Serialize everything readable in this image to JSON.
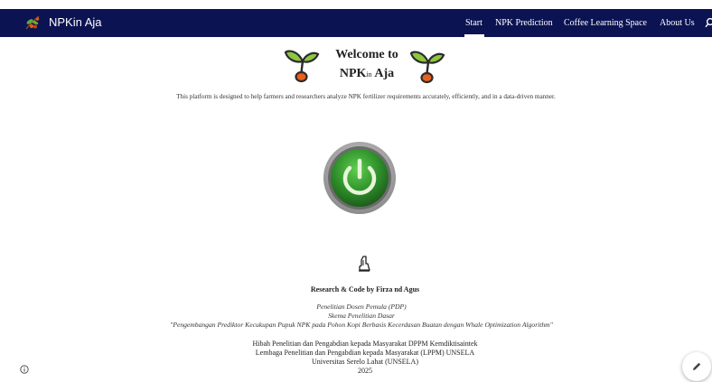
{
  "app": {
    "brand_name": "NPKin Aja",
    "brand_icon": "coffee-branch-logo"
  },
  "nav": {
    "items": [
      {
        "label": "Start",
        "active": true
      },
      {
        "label": "NPK Prediction",
        "active": false
      },
      {
        "label": "Coffee Learning Space",
        "active": false
      },
      {
        "label": "About Us",
        "active": false
      }
    ],
    "search_icon": "search-icon"
  },
  "hero": {
    "welcome_line1": "Welcome to",
    "welcome_npk": "NPK",
    "welcome_in": "in",
    "welcome_aja": "Aja",
    "sprout_icon": "sprout-icon",
    "intro": "This platform is designed to help farmers and researchers analyze NPK fertilizer requirements accurately, efficiently, and in a data-driven manner."
  },
  "start_button": {
    "icon": "power-icon",
    "color": "#2e8f2b"
  },
  "footer": {
    "author_icon": "writing-hand-icon",
    "credit": "Research & Code by Firza nd Agus",
    "program": "Penelitian Dosen Pemula (PDP)",
    "scheme": "Skema Penelitian Dasar",
    "project_title": "\"Pengembangan Prediktor Kecukupan Pupuk NPK pada Pohon Kopi Berbasis Kecerdasan Buatan dengan Whale Optimization Algorithm\"",
    "grant": "Hibah Penelitian dan Pengabdian kepada Masyarakat DPPM Kemdiktisaintek",
    "institute": "Lembaga Penelitian dan Pengabdian kepada Masyarakat (LPPM) UNSELA",
    "university": "Universitas Serelo Lahat (UNSELA)",
    "year": "2025"
  },
  "widgets": {
    "info_icon": "info-icon",
    "edit_icon": "pencil-icon"
  },
  "colors": {
    "navbar": "#0c1352",
    "accent_green": "#2e8f2b",
    "leaf_green": "#8dc63f",
    "seed_orange": "#e8601c"
  }
}
